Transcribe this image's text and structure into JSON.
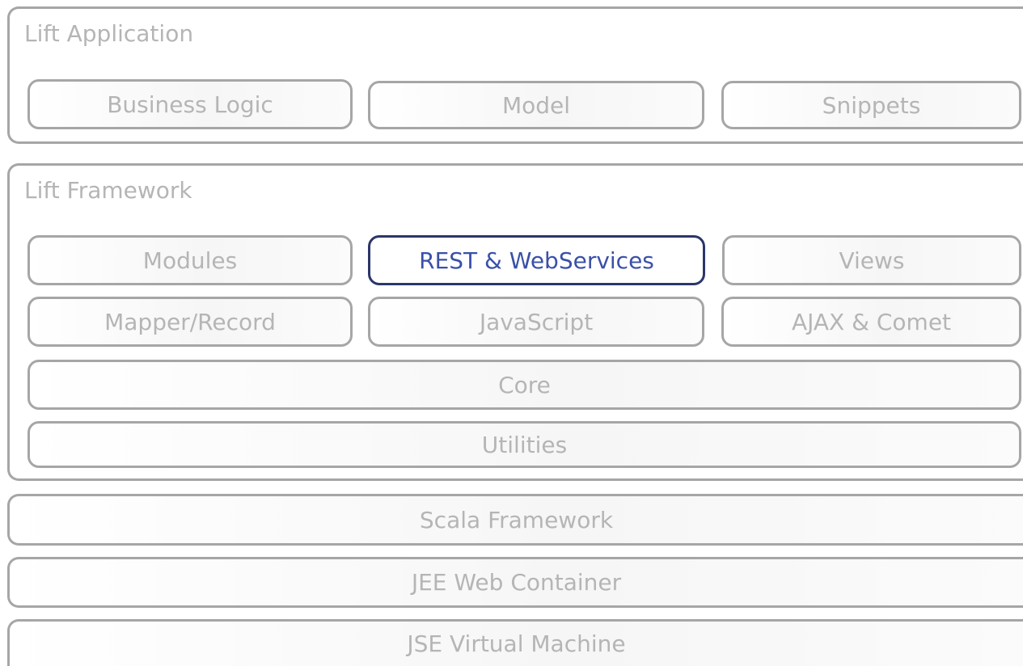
{
  "app": {
    "title": "Lift Application",
    "components": [
      "Business Logic",
      "Model",
      "Snippets"
    ]
  },
  "framework": {
    "title": "Lift Framework",
    "row1": [
      "Modules",
      "REST & WebServices",
      "Views"
    ],
    "row2": [
      "Mapper/Record",
      "JavaScript",
      "AJAX & Comet"
    ],
    "core": "Core",
    "utilities": "Utilities"
  },
  "layers": {
    "scala": "Scala Framework",
    "jee": "JEE Web Container",
    "jse": "JSE Virtual Machine"
  },
  "highlight_color": "#2b3668",
  "highlight_text_color": "#3a50a8"
}
